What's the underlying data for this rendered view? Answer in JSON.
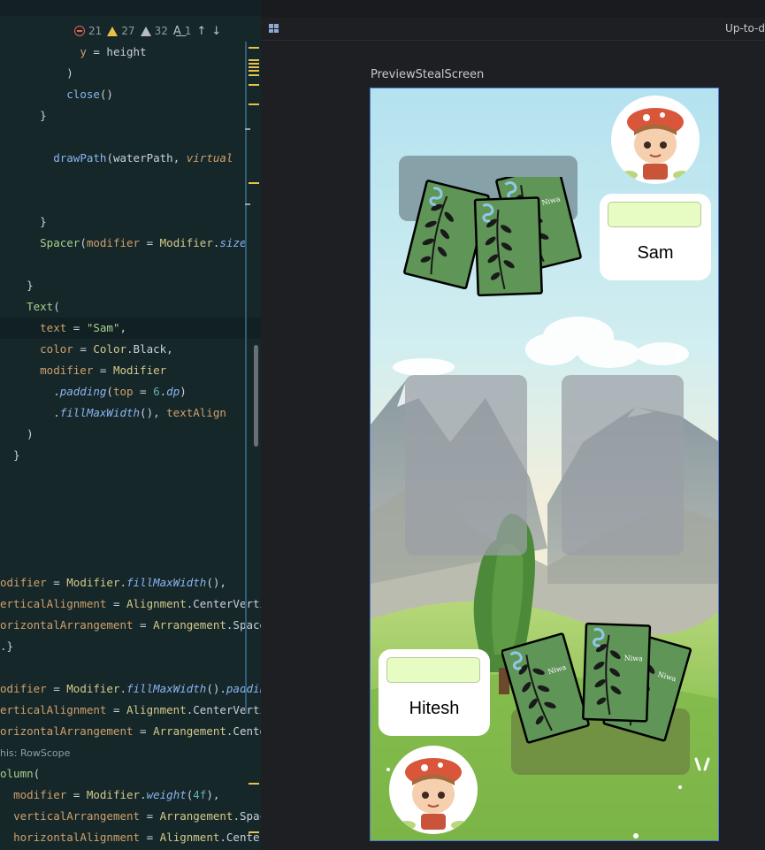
{
  "editor": {
    "inspections": {
      "errors": "21",
      "warnings": "27",
      "weak_warnings": "32",
      "typos": "1"
    },
    "colors": {
      "background": "#16272a",
      "keyword": "#d09a55",
      "function": "#8ab4f0",
      "string": "#a8d08d"
    }
  },
  "preview": {
    "status": "Up-to-d",
    "preview_name": "PreviewStealScreen"
  },
  "game": {
    "top_player": {
      "name": "Sam"
    },
    "bottom_player": {
      "name": "Hitesh"
    },
    "card_label": "Niwa",
    "colors": {
      "card": "#5f9557",
      "hp_bar": "#e6fcc2",
      "slot_top": "#7f9aa0",
      "slot_middle": "#9aa0a6",
      "slot_bottom": "#6f8a42"
    }
  }
}
